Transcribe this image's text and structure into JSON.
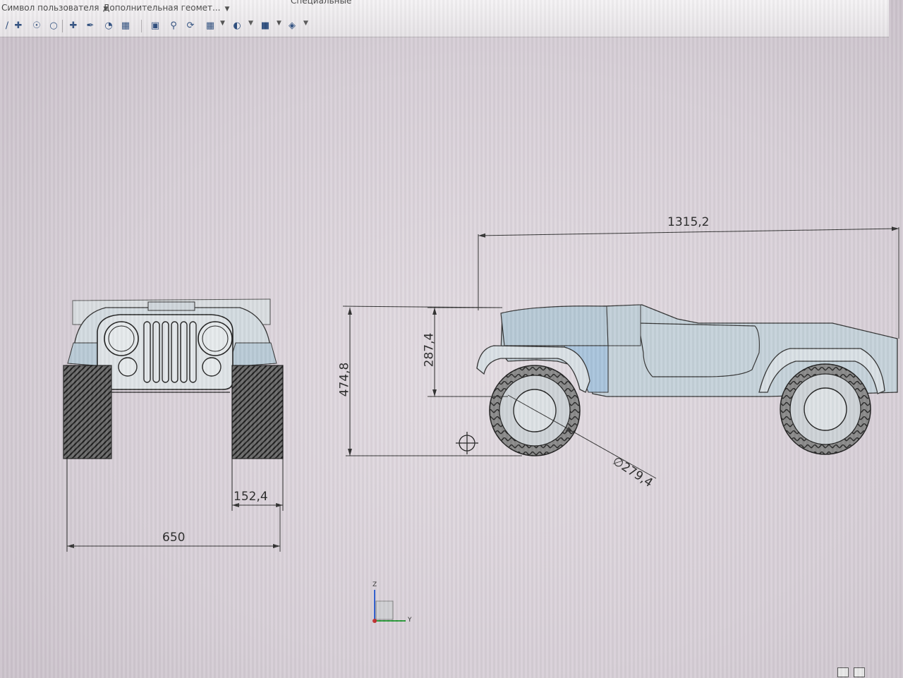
{
  "toolbar": {
    "groups": [
      {
        "label": "Символ пользователя",
        "has_dropdown": true
      },
      {
        "label": "Дополнительная геомет...",
        "has_dropdown": true
      },
      {
        "label": "Специальные",
        "has_dropdown": false
      }
    ],
    "buttons": [
      "line-icon",
      "crosshair-icon",
      "circle-center-icon",
      "circle-icon",
      "point-icon",
      "pen-icon",
      "palette-icon",
      "hatch-icon",
      "zoom-window-icon",
      "zoom-icon",
      "rotate-icon",
      "view-grid-icon",
      "render-icon",
      "cube-icon",
      "light-icon"
    ]
  },
  "drawing": {
    "dimensions": {
      "overall_length": "1315,2",
      "overall_height": "474,8",
      "hood_height": "287,4",
      "wheel_diameter": "∅279,4",
      "tire_width": "152,4",
      "overall_width": "650"
    },
    "axes": {
      "z": "Z",
      "y": "Y"
    }
  },
  "colors": {
    "background": "#dcd5dc",
    "line": "#2a2a2a",
    "axis_z": "#2f5fd0",
    "axis_y": "#2a9a3a",
    "axis_x": "#c03030",
    "body_fill": "#c8d3d9"
  }
}
